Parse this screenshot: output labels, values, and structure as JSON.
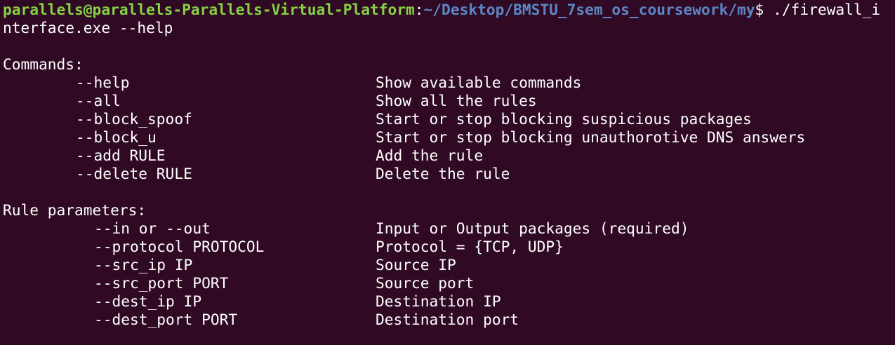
{
  "prompt": {
    "user_host": "parallels@parallels-Parallels-Virtual-Platform",
    "colon": ":",
    "path": "~/Desktop/BMSTU_7sem_os_coursework/my",
    "symbol": "$ ",
    "command": "./firewall_i",
    "command_wrap": "nterface.exe --help",
    "colors": {
      "user_host": "#87d243",
      "path": "#5c86c5",
      "background": "#300a24",
      "text": "#ffffff"
    }
  },
  "commands": {
    "heading": "Commands:",
    "items": [
      {
        "flag": "--help",
        "description": "Show available commands"
      },
      {
        "flag": "--all",
        "description": "Show all the rules"
      },
      {
        "flag": "--block_spoof",
        "description": "Start or stop blocking suspicious packages"
      },
      {
        "flag": "--block_u",
        "description": "Start or stop blocking unauthorotive DNS answers"
      },
      {
        "flag": "--add RULE",
        "description": "Add the rule"
      },
      {
        "flag": "--delete RULE",
        "description": "Delete the rule"
      }
    ]
  },
  "rule_parameters": {
    "heading": "Rule parameters:",
    "items": [
      {
        "flag": "--in or --out",
        "description": "Input or Output packages (required)"
      },
      {
        "flag": "--protocol PROTOCOL",
        "description": "Protocol = {TCP, UDP}"
      },
      {
        "flag": "--src_ip IP",
        "description": "Source IP"
      },
      {
        "flag": "--src_port PORT",
        "description": "Source port"
      },
      {
        "flag": "--dest_ip IP",
        "description": "Destination IP"
      },
      {
        "flag": "--dest_port PORT",
        "description": "Destination port"
      }
    ]
  }
}
